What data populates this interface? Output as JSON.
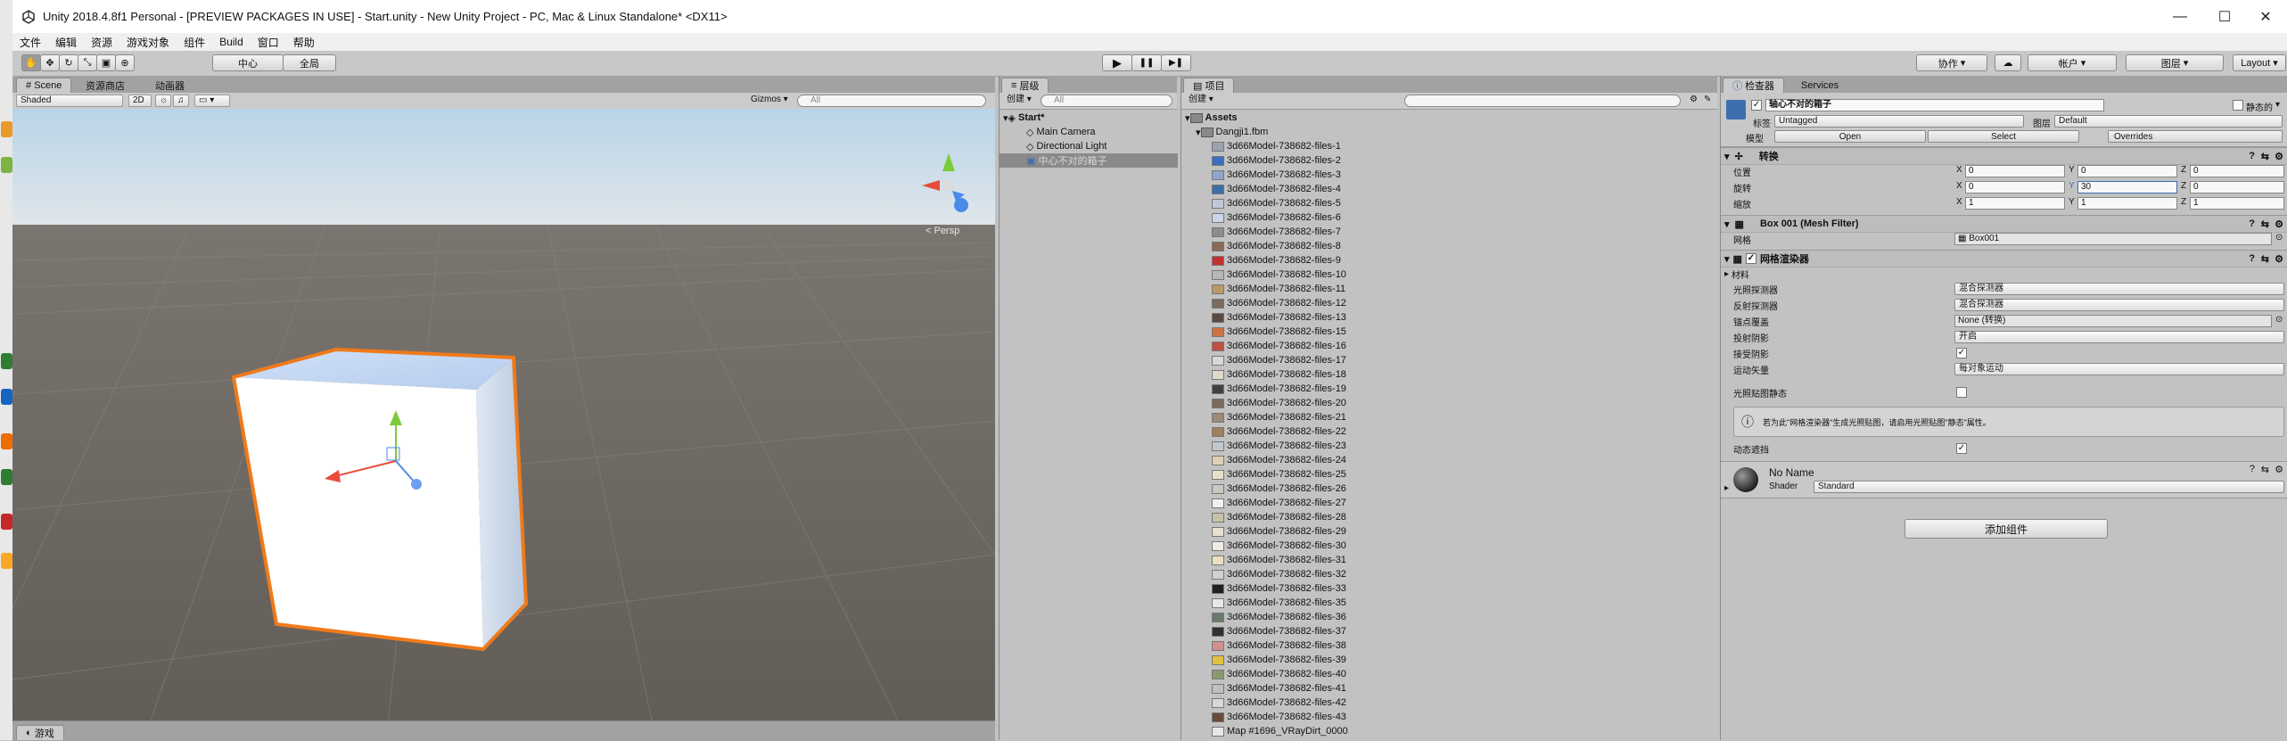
{
  "window": {
    "title": "Unity 2018.4.8f1 Personal - [PREVIEW PACKAGES IN USE] - Start.unity - New Unity Project - PC, Mac & Linux Standalone* <DX11>",
    "minimize": "—",
    "maximize": "☐",
    "close": "✕"
  },
  "menu": [
    "文件",
    "编辑",
    "资源",
    "游戏对象",
    "组件",
    "Build",
    "窗口",
    "帮助"
  ],
  "toolbar": {
    "pivot": "中心",
    "global": "全局",
    "play": "▶",
    "pause": "❚❚",
    "step": "▶❚",
    "collab": "协作",
    "account": "帐户",
    "layers": "图层",
    "layout": "Layout"
  },
  "scene": {
    "tabs": [
      "Scene",
      "资源商店",
      "动画器"
    ],
    "shading": "Shaded",
    "mode2d": "2D",
    "gizmos": "Gizmos",
    "search_placeholder": "All",
    "persp": "< Persp",
    "bottom_tab": "游戏"
  },
  "hierarchy": {
    "tab": "层级",
    "create": "创建",
    "search_placeholder": "All",
    "scene_name": "Start*",
    "items": [
      "Main Camera",
      "Directional Light",
      "中心不对的箱子"
    ]
  },
  "project": {
    "tab": "项目",
    "create": "创建",
    "root": "Assets",
    "fbm": "Dangji1.fbm",
    "files": [
      "3d66Model-738682-files-1",
      "3d66Model-738682-files-2",
      "3d66Model-738682-files-3",
      "3d66Model-738682-files-4",
      "3d66Model-738682-files-5",
      "3d66Model-738682-files-6",
      "3d66Model-738682-files-7",
      "3d66Model-738682-files-8",
      "3d66Model-738682-files-9",
      "3d66Model-738682-files-10",
      "3d66Model-738682-files-11",
      "3d66Model-738682-files-12",
      "3d66Model-738682-files-13",
      "3d66Model-738682-files-15",
      "3d66Model-738682-files-16",
      "3d66Model-738682-files-17",
      "3d66Model-738682-files-18",
      "3d66Model-738682-files-19",
      "3d66Model-738682-files-20",
      "3d66Model-738682-files-21",
      "3d66Model-738682-files-22",
      "3d66Model-738682-files-23",
      "3d66Model-738682-files-24",
      "3d66Model-738682-files-25",
      "3d66Model-738682-files-26",
      "3d66Model-738682-files-27",
      "3d66Model-738682-files-28",
      "3d66Model-738682-files-29",
      "3d66Model-738682-files-30",
      "3d66Model-738682-files-31",
      "3d66Model-738682-files-32",
      "3d66Model-738682-files-33",
      "3d66Model-738682-files-35",
      "3d66Model-738682-files-36",
      "3d66Model-738682-files-37",
      "3d66Model-738682-files-38",
      "3d66Model-738682-files-39",
      "3d66Model-738682-files-40",
      "3d66Model-738682-files-41",
      "3d66Model-738682-files-42",
      "3d66Model-738682-files-43",
      "Map #1696_VRayDirt_0000"
    ],
    "icon_colors": [
      "#9aa4b0",
      "#3a6fbf",
      "#8fa6c8",
      "#3c6ea8",
      "#c0c8d8",
      "#c9d6e6",
      "#8c8c8c",
      "#8a6a55",
      "#c23030",
      "#b7b7b7",
      "#b89a6a",
      "#7a6a5a",
      "#5a4a40",
      "#d07040",
      "#c05040",
      "#d8d8d8",
      "#e0d8c8",
      "#404040",
      "#7a6a5a",
      "#9a8a7a",
      "#a08060",
      "#c0c8d0",
      "#dcd0b0",
      "#e8e0c8",
      "#c8c8c0",
      "#f0f0f0",
      "#c8c0a8",
      "#e8e0d0",
      "#f0ece0",
      "#e8e0c0",
      "#d0d0d0",
      "#202020",
      "#e8e8e8",
      "#6a7a6a",
      "#303030",
      "#d09090",
      "#e0c040",
      "#8a9a70",
      "#c0c0c0",
      "#d8d8d8",
      "#6a4a3a",
      "#e8e8e8"
    ]
  },
  "inspector": {
    "tabs": [
      "检查器",
      "Services"
    ],
    "object_name": "轴心不对的箱子",
    "static": "静态的",
    "tag_label": "标签",
    "tag_value": "Untagged",
    "layer_label": "图层",
    "layer_value": "Default",
    "model_label": "模型",
    "open": "Open",
    "select": "Select",
    "overrides": "Overrides",
    "transform": {
      "title": "转换",
      "position_label": "位置",
      "rotation_label": "旋转",
      "scale_label": "缩放",
      "x": "X",
      "y": "Y",
      "z": "Z",
      "position": [
        "0",
        "0",
        "0"
      ],
      "rotation": [
        "0",
        "30",
        "0"
      ],
      "scale": [
        "1",
        "1",
        "1"
      ]
    },
    "mesh_filter": {
      "title": "Box 001 (Mesh Filter)",
      "mesh_label": "网格",
      "mesh_value": "Box001"
    },
    "mesh_renderer": {
      "title": "网格渲染器",
      "materials": "材料",
      "light_probes_label": "光照探测器",
      "light_probes_value": "混合探测器",
      "reflection_probes_label": "反射探测器",
      "reflection_probes_value": "混合探测器",
      "anchor_label": "锚点覆盖",
      "anchor_value": "None (转换)",
      "cast_shadows_label": "投射阴影",
      "cast_shadows_value": "开启",
      "receive_shadows_label": "接受阴影",
      "motion_vectors_label": "运动矢量",
      "motion_vectors_value": "每对象运动",
      "lightmap_static_label": "光照贴图静态",
      "info": "若为此\"网格渲染器\"生成光照贴图，请启用光照贴图\"静态\"属性。",
      "dynamic_occlusion_label": "动态遮挡"
    },
    "material": {
      "name": "No Name",
      "shader_label": "Shader",
      "shader_value": "Standard"
    },
    "add_component": "添加组件"
  },
  "colors": {
    "selection": "#3d6fb0",
    "outline": "#f07a1a",
    "scene_bg": "#6b6560"
  }
}
